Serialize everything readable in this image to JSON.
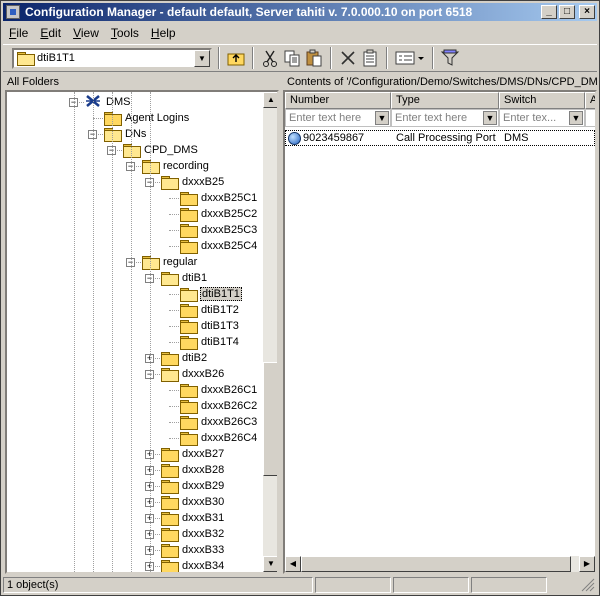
{
  "window": {
    "title": "Configuration Manager - default default, Server tahiti v. 7.0.000.10 on port 6518",
    "controls": [
      "_",
      "□",
      "×"
    ]
  },
  "menu": [
    "File",
    "Edit",
    "View",
    "Tools",
    "Help"
  ],
  "toolbar": {
    "location_value": "dtiB1T1",
    "icons": [
      "up-folder-icon",
      "cut-icon",
      "copy-icon",
      "paste-icon",
      "delete-icon",
      "properties-icon",
      "view-icon",
      "filter-icon"
    ]
  },
  "left_pane": {
    "header": "All Folders",
    "tree": [
      {
        "label": "DMS",
        "level": 0,
        "icon": "switch-icon",
        "expander": "minus"
      },
      {
        "label": "Agent Logins",
        "level": 1,
        "icon": "folder",
        "expander": "none"
      },
      {
        "label": "DNs",
        "level": 1,
        "icon": "folder-open",
        "expander": "minus"
      },
      {
        "label": "CPD_DMS",
        "level": 2,
        "icon": "folder-open",
        "expander": "minus"
      },
      {
        "label": "recording",
        "level": 3,
        "icon": "folder-open",
        "expander": "minus"
      },
      {
        "label": "dxxxB25",
        "level": 4,
        "icon": "folder-open",
        "expander": "minus"
      },
      {
        "label": "dxxxB25C1",
        "level": 5,
        "icon": "folder",
        "expander": "none"
      },
      {
        "label": "dxxxB25C2",
        "level": 5,
        "icon": "folder",
        "expander": "none"
      },
      {
        "label": "dxxxB25C3",
        "level": 5,
        "icon": "folder",
        "expander": "none"
      },
      {
        "label": "dxxxB25C4",
        "level": 5,
        "icon": "folder",
        "expander": "none"
      },
      {
        "label": "regular",
        "level": 3,
        "icon": "folder-open",
        "expander": "minus"
      },
      {
        "label": "dtiB1",
        "level": 4,
        "icon": "folder-open",
        "expander": "minus"
      },
      {
        "label": "dtiB1T1",
        "level": 5,
        "icon": "folder-open",
        "expander": "none",
        "selected": true
      },
      {
        "label": "dtiB1T2",
        "level": 5,
        "icon": "folder",
        "expander": "none"
      },
      {
        "label": "dtiB1T3",
        "level": 5,
        "icon": "folder",
        "expander": "none"
      },
      {
        "label": "dtiB1T4",
        "level": 5,
        "icon": "folder",
        "expander": "none"
      },
      {
        "label": "dtiB2",
        "level": 4,
        "icon": "folder",
        "expander": "plus"
      },
      {
        "label": "dxxxB26",
        "level": 4,
        "icon": "folder-open",
        "expander": "minus"
      },
      {
        "label": "dxxxB26C1",
        "level": 5,
        "icon": "folder",
        "expander": "none"
      },
      {
        "label": "dxxxB26C2",
        "level": 5,
        "icon": "folder",
        "expander": "none"
      },
      {
        "label": "dxxxB26C3",
        "level": 5,
        "icon": "folder",
        "expander": "none"
      },
      {
        "label": "dxxxB26C4",
        "level": 5,
        "icon": "folder",
        "expander": "none"
      },
      {
        "label": "dxxxB27",
        "level": 4,
        "icon": "folder",
        "expander": "plus"
      },
      {
        "label": "dxxxB28",
        "level": 4,
        "icon": "folder",
        "expander": "plus"
      },
      {
        "label": "dxxxB29",
        "level": 4,
        "icon": "folder",
        "expander": "plus"
      },
      {
        "label": "dxxxB30",
        "level": 4,
        "icon": "folder",
        "expander": "plus"
      },
      {
        "label": "dxxxB31",
        "level": 4,
        "icon": "folder",
        "expander": "plus"
      },
      {
        "label": "dxxxB32",
        "level": 4,
        "icon": "folder",
        "expander": "plus"
      },
      {
        "label": "dxxxB33",
        "level": 4,
        "icon": "folder",
        "expander": "plus"
      },
      {
        "label": "dxxxB34",
        "level": 4,
        "icon": "folder",
        "expander": "plus"
      }
    ]
  },
  "right_pane": {
    "header": "Contents of '/Configuration/Demo/Switches/DMS/DNs/CPD_DMS/r",
    "columns": [
      "Number",
      "Type",
      "Switch",
      "A"
    ],
    "filter_placeholders": [
      "Enter text here",
      "Enter text here",
      "Enter tex..."
    ],
    "rows": [
      {
        "number": "9023459867",
        "type": "Call Processing Port",
        "switch": "DMS"
      }
    ]
  },
  "status": {
    "text": "1 object(s)"
  }
}
